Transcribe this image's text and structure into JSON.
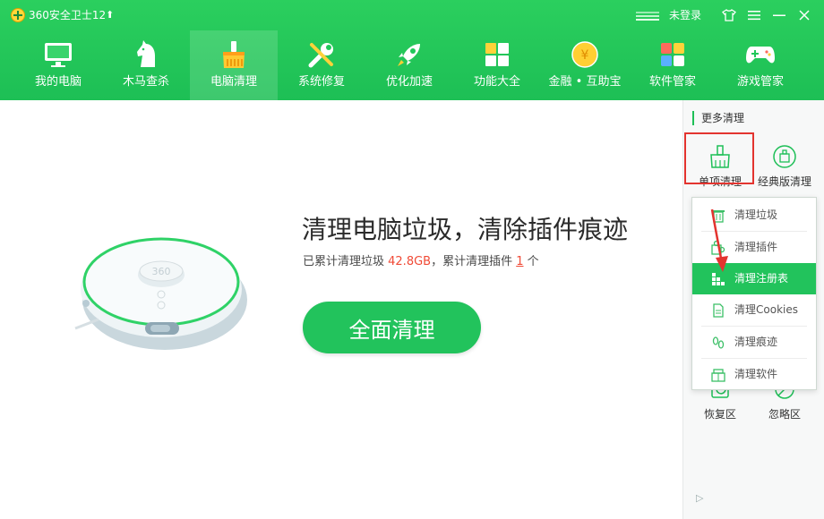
{
  "app": {
    "title": "360安全卫士12",
    "update_glyph": "⬆",
    "login": "未登录"
  },
  "window": {
    "skin": "shirt-icon",
    "menu": "menu-icon",
    "minimize": "minimize-icon",
    "close": "close-icon"
  },
  "nav": [
    {
      "label": "我的电脑",
      "icon": "monitor-icon",
      "active": false
    },
    {
      "label": "木马查杀",
      "icon": "horse-icon",
      "active": false
    },
    {
      "label": "电脑清理",
      "icon": "broom-icon",
      "active": true
    },
    {
      "label": "系统修复",
      "icon": "wrench-icon",
      "active": false
    },
    {
      "label": "优化加速",
      "icon": "rocket-icon",
      "active": false
    },
    {
      "label": "功能大全",
      "icon": "grid-icon",
      "active": false
    },
    {
      "label": "金融 • 互助宝",
      "icon": "coin-icon",
      "active": false
    },
    {
      "label": "软件管家",
      "icon": "apps-icon",
      "active": false
    },
    {
      "label": "游戏管家",
      "icon": "gamepad-icon",
      "active": false
    }
  ],
  "main": {
    "robot_label": "360",
    "headline": "清理电脑垃圾，清除插件痕迹",
    "stats_prefix": "已累计清理垃圾 ",
    "stats_size": "42.8GB",
    "stats_mid": "，累计清理插件 ",
    "stats_count": "1",
    "stats_suffix": " 个",
    "clean_button": "全面清理"
  },
  "sidebar": {
    "title": "更多清理",
    "tools": [
      {
        "label": "单项清理",
        "icon": "broom-icon"
      },
      {
        "label": "经典版清理",
        "icon": "classic-clean-icon"
      },
      {
        "label": "恢复区",
        "icon": "restore-icon"
      },
      {
        "label": "忽略区",
        "icon": "ignore-icon"
      }
    ],
    "expand_glyph": "▷"
  },
  "menu": [
    {
      "label": "清理垃圾",
      "icon": "trash-icon",
      "selected": false
    },
    {
      "label": "清理插件",
      "icon": "plugin-icon",
      "selected": false
    },
    {
      "label": "清理注册表",
      "icon": "registry-icon",
      "selected": true
    },
    {
      "label": "清理Cookies",
      "icon": "cookie-doc-icon",
      "selected": false
    },
    {
      "label": "清理痕迹",
      "icon": "footprint-icon",
      "selected": false
    },
    {
      "label": "清理软件",
      "icon": "software-box-icon",
      "selected": false
    }
  ],
  "colors": {
    "brand_green": "#1ebf57",
    "accent_red": "#e3342f",
    "highlight": "#f04a36"
  }
}
